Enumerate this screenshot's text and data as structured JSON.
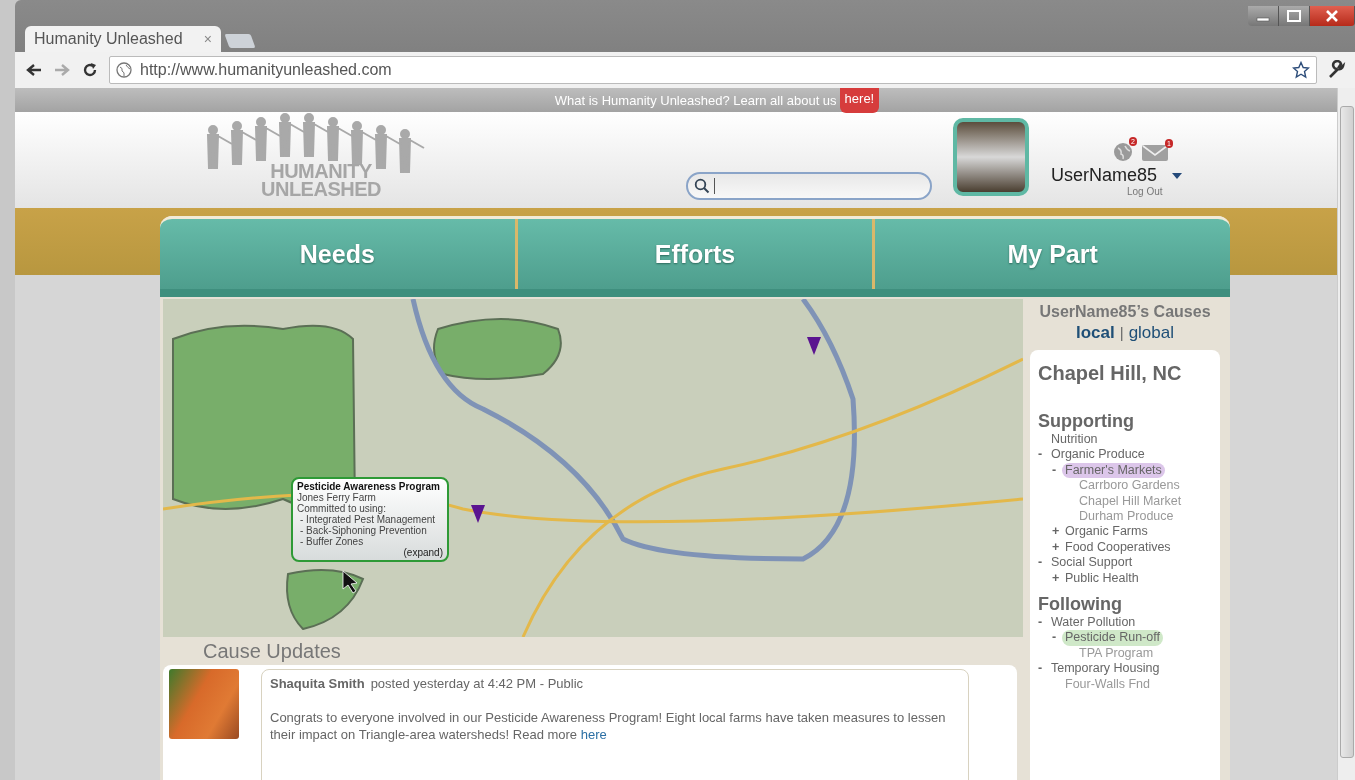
{
  "browser": {
    "tab_title": "Humanity Unleashed",
    "tab_close": "×",
    "url": "http://www.humanityunleashed.com"
  },
  "banner": {
    "text": "What is Humanity Unleashed? Learn all about us",
    "link": "here!"
  },
  "header": {
    "logo_lines": [
      "HUMANITY",
      "UNLEASHED"
    ],
    "notifications": [
      {
        "kind": "globe",
        "count": "2"
      },
      {
        "kind": "mail",
        "count": "1"
      }
    ],
    "username": "UserName85",
    "logout": "Log Out"
  },
  "nav": [
    {
      "label": "Needs"
    },
    {
      "label": "Efforts"
    },
    {
      "label": "My Part"
    }
  ],
  "map": {
    "popup": {
      "title": "Pesticide Awareness Program",
      "subtitle": "Jones Ferry Farm",
      "intro": "Committed to using:",
      "items": [
        "- Integrated Pest Management",
        "- Back-Siphoning Prevention",
        "- Buffer Zones"
      ],
      "expand": "(expand)"
    }
  },
  "sidebar": {
    "title": "UserName85’s Causes",
    "scopes": [
      {
        "label": "local",
        "selected": true
      },
      {
        "label": "global",
        "selected": false
      }
    ],
    "separator": "|",
    "location": "Chapel Hill, NC",
    "sections": [
      {
        "heading": "Supporting",
        "items": [
          {
            "label": "Nutrition"
          },
          {
            "label": "Organic Produce",
            "sign": "-",
            "children": [
              {
                "label": "Farmer's Markets",
                "sign": "-",
                "color": "#dcc6ea",
                "children": [
                  {
                    "label": "Carrboro Gardens"
                  },
                  {
                    "label": "Chapel Hill Market"
                  },
                  {
                    "label": "Durham Produce"
                  }
                ]
              },
              {
                "label": "Organic Farms",
                "sign": "+"
              },
              {
                "label": "Food Cooperatives",
                "sign": "+"
              }
            ]
          },
          {
            "label": "Social Support",
            "sign": "-",
            "children": [
              {
                "label": "Public Health",
                "sign": "+"
              }
            ]
          }
        ]
      },
      {
        "heading": "Following",
        "items": [
          {
            "label": "Water Pollution",
            "sign": "-",
            "children": [
              {
                "label": "Pesticide Run-off",
                "sign": "-",
                "color": "#cfe8c8",
                "children": [
                  {
                    "label": "TPA Program"
                  }
                ]
              }
            ]
          },
          {
            "label": "Temporary Housing",
            "sign": "-",
            "children": [
              {
                "label": "Four-Walls Fnd"
              }
            ]
          }
        ]
      }
    ]
  },
  "updates": {
    "title": "Cause Updates",
    "posts": [
      {
        "author": "Shaquita Smith",
        "meta": "posted yesterday at 4:42 PM - Public",
        "body": "Congrats to everyone involved in our Pesticide Awareness Program! Eight local farms have taken measures to lessen their impact on Triangle-area watersheds! Read more",
        "link": "here"
      }
    ]
  }
}
